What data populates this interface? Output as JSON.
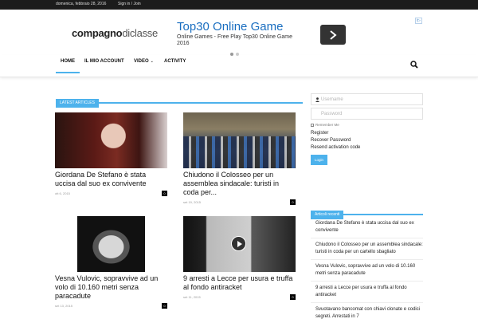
{
  "topbar": {
    "date": "domenica, febbraio 28, 2016",
    "signin": "Sign in / Join"
  },
  "logo": {
    "part1": "compagno",
    "part2": "diclasse"
  },
  "ad": {
    "badge": "i▷",
    "title": "Top30 Online Game",
    "desc_line1": "Online Games - Free Play Top30 Online Game",
    "desc_line2": "2016",
    "go_icon": "chevron-right-icon"
  },
  "nav": {
    "items": [
      "HOME",
      "IL MIO ACCOUNT",
      "VIDEO",
      "ACTIVITY"
    ],
    "video_chevron": "⌄",
    "accent": "#4db2ec"
  },
  "latest": {
    "title": "LATEST ARTICLES",
    "articles": [
      {
        "title": "Giordana De Stefano è stata uccisa dal suo ex convivente",
        "date": "ott 6, 2015",
        "count": "0"
      },
      {
        "title": "Chiudono il Colosseo per un assemblea sindacale: turisti in coda per...",
        "date": "set 19, 2015",
        "count": "0"
      },
      {
        "title": "Vesna Vulovic, sopravvive ad un volo di 10.160 metri senza paracadute",
        "date": "set 13, 2015",
        "count": "0"
      },
      {
        "title": "9 arresti a Lecce per usura e truffa al fondo antiracket",
        "date": "set 11, 2015",
        "count": "0"
      }
    ]
  },
  "login": {
    "username_placeholder": "Username",
    "password_placeholder": "Password",
    "remember": "Remember Me",
    "register": "Register",
    "recover": "Recover Password",
    "resend": "Resend activation code",
    "button": "Login"
  },
  "recent": {
    "title": "Articoli recenti",
    "items": [
      "Giordana De Stefano è stata uccisa dal suo ex convivente",
      "Chiudono il Colosseo per un assemblea sindacale: turisti in coda per un cartello sbagliato",
      "Vesna Vulovic, sopravvive ad un volo di 10.160 metri senza paracadute",
      "9 arresti a Lecce per usura e truffa al fondo antiracket",
      "Svuotavano bancomat con chiavi clonate e codici segreti. Arrestati in 7"
    ]
  }
}
